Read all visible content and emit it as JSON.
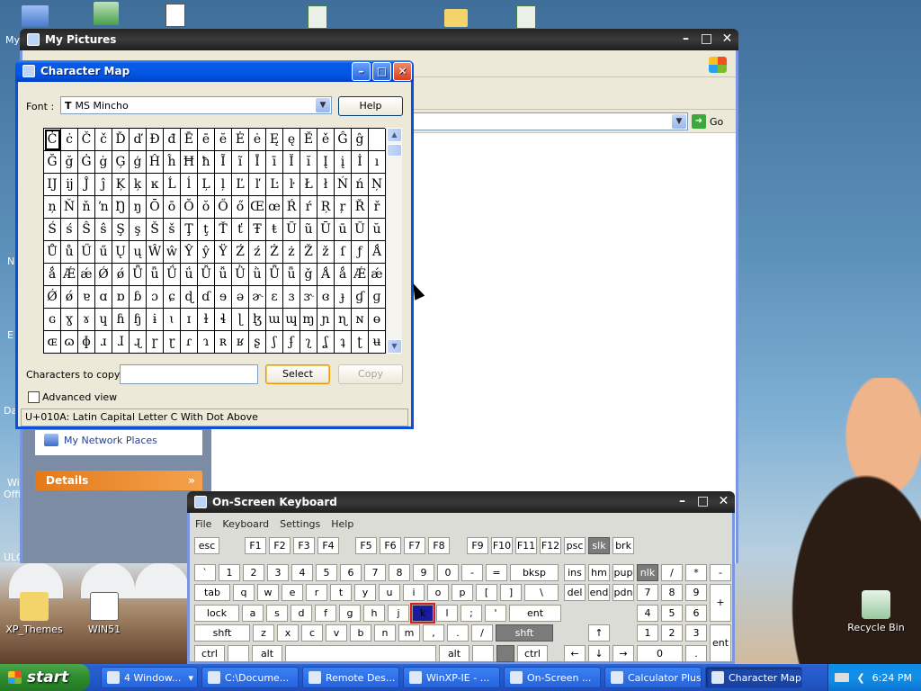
{
  "desktop": {
    "icons": [
      {
        "label": "My",
        "icon": "my-computer-icon"
      },
      {
        "label": "XP_Themes",
        "icon": "folder-zip-icon"
      },
      {
        "label": "WIN51",
        "icon": "file-icon"
      },
      {
        "label": "Recycle Bin",
        "icon": "recycle-bin-icon"
      }
    ],
    "edge_labels": [
      "My",
      "N",
      "E",
      "Da",
      "Wi",
      "Offi",
      "ULC"
    ]
  },
  "my_pictures": {
    "title": "My Pictures",
    "go_label": "Go",
    "network_places": "My Network Places",
    "details": "Details"
  },
  "charmap": {
    "title": "Character Map",
    "font_label": "Font :",
    "font_value": "MS Mincho",
    "help": "Help",
    "chars_to_copy_label": "Characters to copy :",
    "chars_to_copy_value": "",
    "select": "Select",
    "copy": "Copy",
    "advanced_view": "Advanced view",
    "status": "U+010A: Latin Capital Letter C With Dot Above",
    "grid": [
      [
        "Ċ",
        "ċ",
        "Č",
        "č",
        "Ď",
        "ď",
        "Đ",
        "đ",
        "Ē",
        "ē",
        "ĕ",
        "Ė",
        "ė",
        "Ę",
        "ę",
        "Ě",
        "ě",
        "Ĝ",
        "ĝ"
      ],
      [
        "Ğ",
        "ğ",
        "Ġ",
        "ġ",
        "Ģ",
        "ģ",
        "Ĥ",
        "ĥ",
        "Ħ",
        "ħ",
        "Ĩ",
        "ĩ",
        "Ī",
        "ī",
        "Ĭ",
        "ĭ",
        "Į",
        "į",
        "İ",
        "ı"
      ],
      [
        "Ĳ",
        "ĳ",
        "Ĵ",
        "ĵ",
        "Ķ",
        "ķ",
        "ĸ",
        "Ĺ",
        "ĺ",
        "Ļ",
        "ļ",
        "Ľ",
        "ľ",
        "Ŀ",
        "ŀ",
        "Ł",
        "ł",
        "Ń",
        "ń",
        "Ņ"
      ],
      [
        "ņ",
        "Ň",
        "ň",
        "ŉ",
        "Ŋ",
        "ŋ",
        "Ō",
        "ō",
        "Ŏ",
        "ŏ",
        "Ő",
        "ő",
        "Œ",
        "œ",
        "Ŕ",
        "ŕ",
        "Ŗ",
        "ŗ",
        "Ř",
        "ř"
      ],
      [
        "Ś",
        "ś",
        "Ŝ",
        "ŝ",
        "Ş",
        "ş",
        "Š",
        "š",
        "Ţ",
        "ţ",
        "Ť",
        "ť",
        "Ŧ",
        "ŧ",
        "Ũ",
        "ũ",
        "Ū",
        "ū",
        "Ŭ",
        "ŭ"
      ],
      [
        "Ů",
        "ů",
        "Ű",
        "ű",
        "Ų",
        "ų",
        "Ŵ",
        "ŵ",
        "Ŷ",
        "ŷ",
        "Ÿ",
        "Ź",
        "ź",
        "Ż",
        "ż",
        "Ž",
        "ž",
        "ſ",
        "ƒ",
        "Ǻ"
      ],
      [
        "ǻ",
        "Ǽ",
        "ǽ",
        "Ǿ",
        "ǿ",
        "Ǖ",
        "ǖ",
        "Ǘ",
        "ǘ",
        "Ǚ",
        "ǚ",
        "Ǜ",
        "ǜ",
        "Ǖ",
        "ǖ",
        "ǧ",
        "Ǻ",
        "ǻ",
        "Ǽ",
        "ǽ"
      ],
      [
        "Ǿ",
        "ǿ",
        "ɐ",
        "ɑ",
        "ɒ",
        "ɓ",
        "ɔ",
        "ɕ",
        "ɖ",
        "ɗ",
        "ɘ",
        "ə",
        "ɚ",
        "ɛ",
        "ɜ",
        "ɝ",
        "ɞ",
        "ɟ",
        "ɠ",
        "ɡ"
      ],
      [
        "ɢ",
        "ɣ",
        "ɤ",
        "ɥ",
        "ɦ",
        "ɧ",
        "ɨ",
        "ɩ",
        "ɪ",
        "ɫ",
        "ɬ",
        "ɭ",
        "ɮ",
        "ɯ",
        "ɰ",
        "ɱ",
        "ɲ",
        "ɳ",
        "ɴ",
        "ɵ"
      ],
      [
        "ɶ",
        "ɷ",
        "ɸ",
        "ɹ",
        "ɺ",
        "ɻ",
        "ɼ",
        "ɽ",
        "ɾ",
        "ɿ",
        "ʀ",
        "ʁ",
        "ʂ",
        "ʃ",
        "ʄ",
        "ʅ",
        "ʆ",
        "ʇ",
        "ʈ",
        "ʉ"
      ]
    ]
  },
  "osk": {
    "title": "On-Screen Keyboard",
    "menu": [
      "File",
      "Keyboard",
      "Settings",
      "Help"
    ],
    "rows": {
      "r1": [
        "esc",
        "F1",
        "F2",
        "F3",
        "F4",
        "F5",
        "F6",
        "F7",
        "F8",
        "F9",
        "F10",
        "F11",
        "F12",
        "psc",
        "slk",
        "brk"
      ],
      "r2": [
        "`",
        "1",
        "2",
        "3",
        "4",
        "5",
        "6",
        "7",
        "8",
        "9",
        "0",
        "-",
        "=",
        "bksp",
        "ins",
        "hm",
        "pup",
        "nlk",
        "/",
        "*",
        "-"
      ],
      "r3": [
        "tab",
        "q",
        "w",
        "e",
        "r",
        "t",
        "y",
        "u",
        "i",
        "o",
        "p",
        "[",
        "]",
        "\\",
        "del",
        "end",
        "pdn",
        "7",
        "8",
        "9",
        "+"
      ],
      "r4": [
        "lock",
        "a",
        "s",
        "d",
        "f",
        "g",
        "h",
        "j",
        "k",
        "l",
        ";",
        "'",
        "ent",
        "4",
        "5",
        "6"
      ],
      "r5": [
        "shft",
        "z",
        "x",
        "c",
        "v",
        "b",
        "n",
        "m",
        ",",
        ".",
        "/",
        "shft",
        "↑",
        "1",
        "2",
        "3",
        "ent"
      ],
      "r6": [
        "ctrl",
        "",
        "alt",
        "",
        "alt",
        "",
        "",
        "ctrl",
        "←",
        "↓",
        "→",
        "0",
        "."
      ]
    }
  },
  "taskbar": {
    "start": "start",
    "tasks": [
      "4 Window...",
      "C:\\Docume...",
      "Remote Des...",
      "WinXP-IE - ...",
      "On-Screen ...",
      "Calculator Plus",
      "Character Map"
    ],
    "clock": "6:24 PM"
  }
}
